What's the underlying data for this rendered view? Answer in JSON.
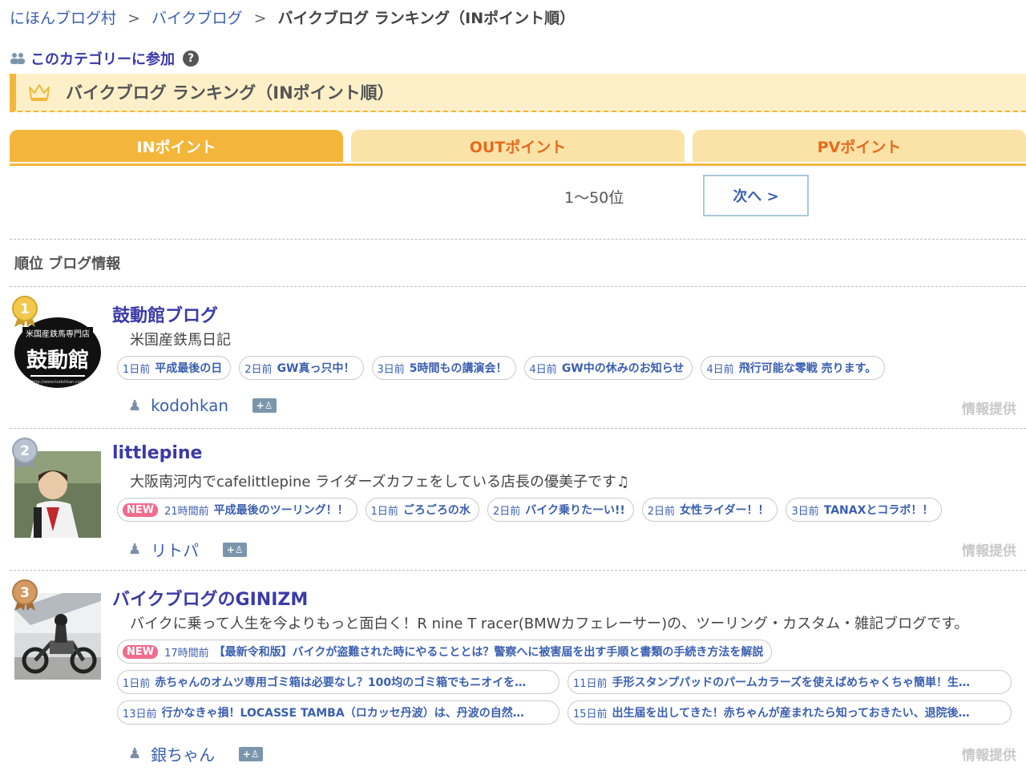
{
  "breadcrumb": {
    "home": "にほんブログ村",
    "category": "バイクブログ",
    "current": "バイクブログ ランキング（INポイント順）",
    "sep": ">"
  },
  "join": {
    "label": "このカテゴリーに参加",
    "help": "?"
  },
  "page_title": "バイクブログ ランキング（INポイント順）",
  "tabs": [
    {
      "label": "INポイント",
      "active": true
    },
    {
      "label": "OUTポイント",
      "active": false
    },
    {
      "label": "PVポイント",
      "active": false
    }
  ],
  "pager": {
    "range": "1〜50位",
    "next": "次へ >"
  },
  "table_head": "順位  ブログ情報",
  "rows": [
    {
      "rank": "1",
      "title": "鼓動館ブログ",
      "description": "米国産鉄馬日記",
      "thumb_text": {
        "top": "米国産鉄馬専門店",
        "main": "鼓動館",
        "url": "http://www.kodohkan.com"
      },
      "articles": [
        {
          "date": "1日前",
          "title": "平成最後の日"
        },
        {
          "date": "2日前",
          "title": "GW真っ只中！"
        },
        {
          "date": "3日前",
          "title": "5時間もの講演会！"
        },
        {
          "date": "4日前",
          "title": "GW中の休みのお知らせ"
        },
        {
          "date": "4日前",
          "title": "飛行可能な零戦 売ります。"
        }
      ],
      "author": "kodohkan",
      "info": "情報提供"
    },
    {
      "rank": "2",
      "title": "littlepine",
      "description": "大阪南河内でcafelittlepine ライダーズカフェをしている店長の優美子です♫",
      "articles": [
        {
          "badge": "NEW",
          "date": "21時間前",
          "title": "平成最後のツーリング！！"
        },
        {
          "date": "1日前",
          "title": "ごろごろの水"
        },
        {
          "date": "2日前",
          "title": "バイク乗りたーい!!"
        },
        {
          "date": "2日前",
          "title": "女性ライダー！！"
        },
        {
          "date": "3日前",
          "title": "TANAXとコラボ！！"
        }
      ],
      "author": "リトパ",
      "info": "情報提供"
    },
    {
      "rank": "3",
      "title": "バイクブログのGINIZM",
      "description": "バイクに乗って人生を今よりもっと面白く！R nine T racer(BMWカフェレーサー)の、ツーリング・カスタム・雑記ブログです。",
      "articles": [
        {
          "badge": "NEW",
          "date": "17時間前",
          "title": "【最新令和版】バイクが盗難された時にやることとは？警察へに被害届を出す手順と書類の手続き方法を解説"
        },
        {
          "date": "1日前",
          "title": "赤ちゃんのオムツ専用ゴミ箱は必要なし？100均のゴミ箱でもニオイを…"
        },
        {
          "date": "11日前",
          "title": "手形スタンプパッドのパームカラーズを使えばめちゃくちゃ簡単！生…"
        },
        {
          "date": "13日前",
          "title": "行かなきゃ損！LOCASSE TAMBA（ロカッセ丹波）は、丹波の自然…"
        },
        {
          "date": "15日前",
          "title": "出生届を出してきた！赤ちゃんが産まれたら知っておきたい、退院後…"
        }
      ],
      "author": "銀ちゃん",
      "info": "情報提供"
    }
  ],
  "follow_label": "+",
  "colors": {
    "accent": "#f3b63b",
    "link": "#3a5fb0",
    "title": "#3a3aa8",
    "new_badge": "#f06c8d"
  }
}
